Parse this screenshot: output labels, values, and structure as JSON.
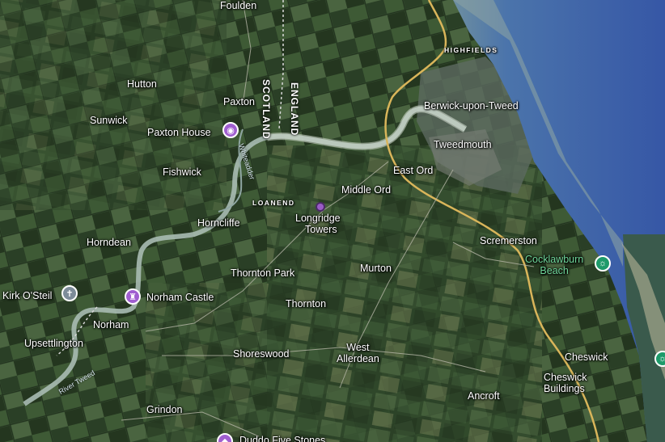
{
  "map": {
    "type": "satellite",
    "colors": {
      "sea": "#3b5fa8",
      "land": "#344c2f",
      "road": "#d9b55a",
      "river": "#9fb8b0"
    },
    "places": {
      "foulden": "Foulden",
      "highfields": "HIGHFIELDS",
      "hutton": "Hutton",
      "paxton": "Paxton",
      "scotland": "SCOTLAND",
      "england": "ENGLAND",
      "berwick": "Berwick-upon-Tweed",
      "sunwick": "Sunwick",
      "paxton_house": "Paxton House",
      "tweedmouth": "Tweedmouth",
      "fishwick": "Fishwick",
      "east_ord": "East Ord",
      "loanend": "LOANEND",
      "middle_ord": "Middle Ord",
      "longridge_line1": "Longridge",
      "longridge_line2": "Towers",
      "horncliffe": "Horncliffe",
      "horndean": "Horndean",
      "scremerston": "Scremerston",
      "cocklawburn_line1": "Cocklawburn",
      "cocklawburn_line2": "Beach",
      "thornton_park": "Thornton Park",
      "murton": "Murton",
      "kirk_o_steil": "Kirk O'Steil",
      "norham_castle": "Norham Castle",
      "thornton": "Thornton",
      "norham": "Norham",
      "upsettlington": "Upsettlington",
      "shoreswood": "Shoreswood",
      "west_allerdean_line1": "West",
      "west_allerdean_line2": "Allerdean",
      "cheswick": "Cheswick",
      "cheswick_buildings_line1": "Cheswick",
      "cheswick_buildings_line2": "Buildings",
      "ancroft": "Ancroft",
      "grindon": "Grindon",
      "duddo_partial": "Duddo Five Stones",
      "river_whiteadder": "Whiteadder",
      "river_tweed": "River Tweed"
    },
    "icons": {
      "paxton_house": "camera-icon",
      "norham_castle": "castle-icon",
      "kirk_o_steil": "church-icon",
      "cocklawburn": "beach-icon",
      "duddo": "monument-icon",
      "longridge": "place-dot-icon"
    }
  }
}
